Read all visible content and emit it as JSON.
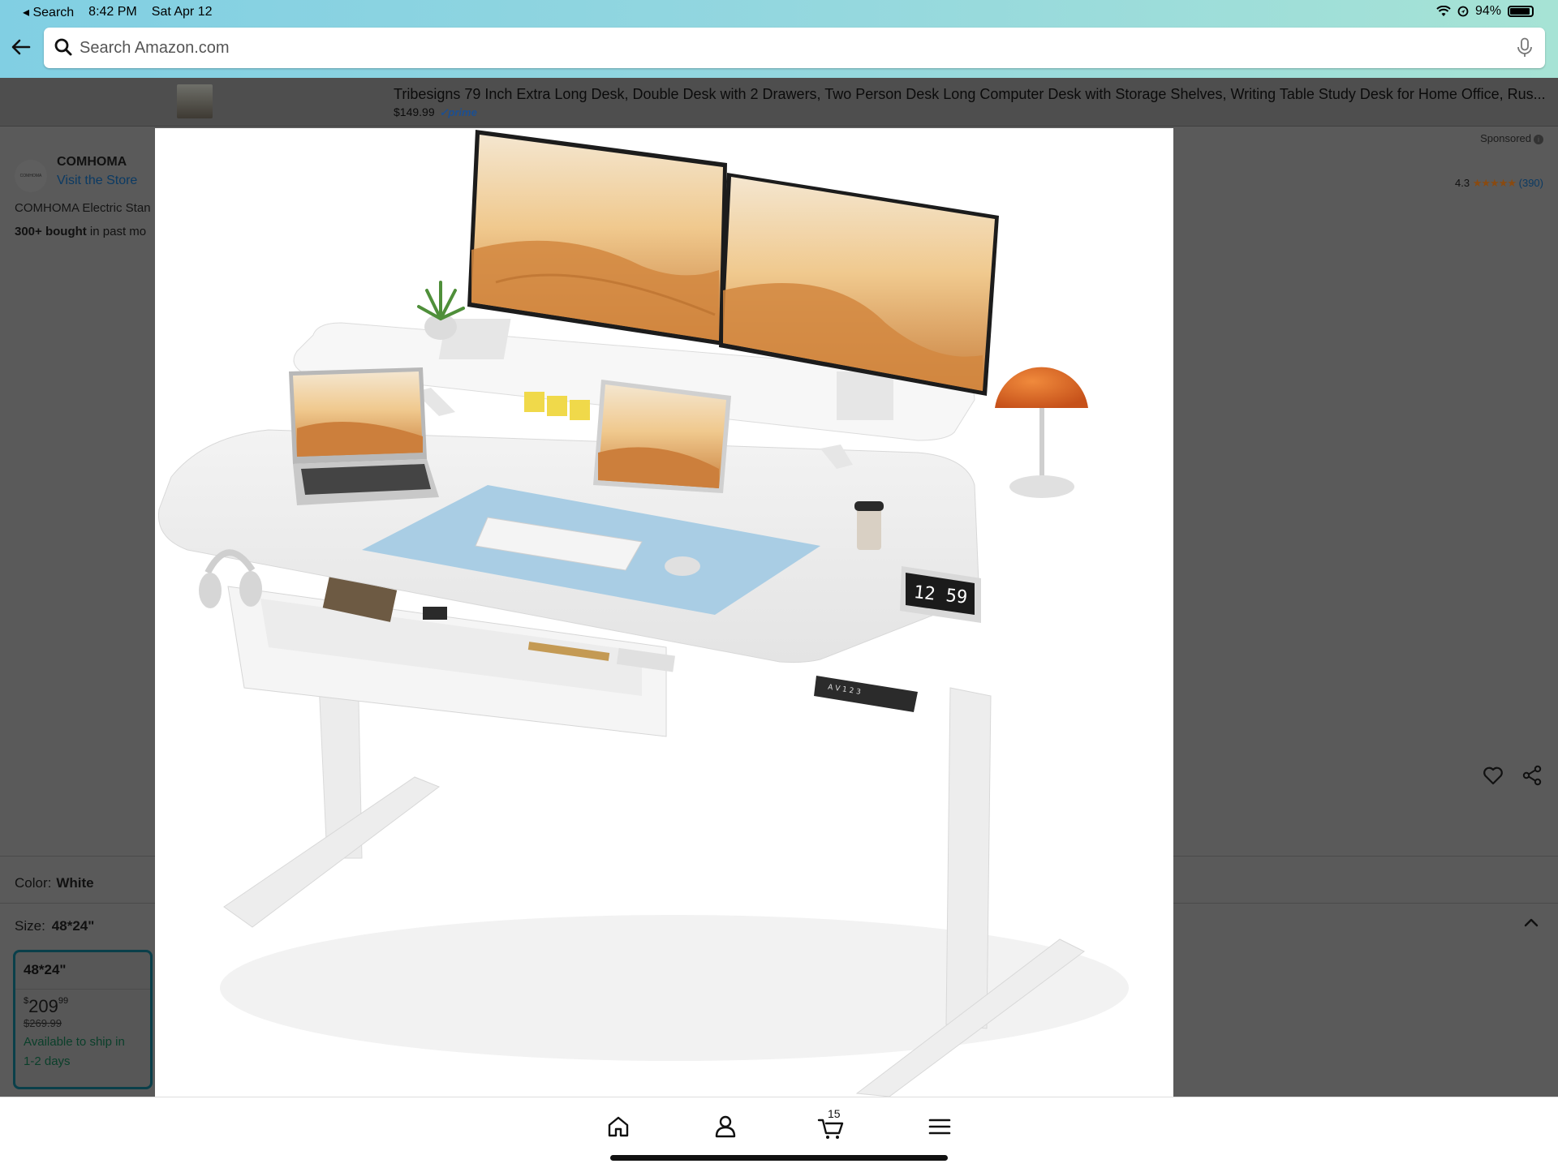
{
  "status_bar": {
    "back_app": "◂ Search",
    "time": "8:42 PM",
    "date": "Sat Apr 12",
    "battery": "94%"
  },
  "search": {
    "placeholder": "Search Amazon.com"
  },
  "ad": {
    "title": "Tribesigns 79 Inch Extra Long Desk, Double Desk with 2 Drawers, Two Person Desk Long Computer Desk with Storage Shelves, Writing Table Study Desk for Home Office, Rus...",
    "price": "$149.99",
    "prime": "✓prime"
  },
  "product": {
    "brand_logo_text": "COMHOMA",
    "brand": "COMHOMA",
    "visit_store": "Visit the Store",
    "title_fragment": "COMHOMA Electric Stan",
    "bought_bold": "300+ bought",
    "bought_rest": " in past mo",
    "sponsored": "Sponsored",
    "rating_value": "4.3",
    "rating_stars": "★★★★★",
    "rating_count": "(390)",
    "color_label": "Color:",
    "color_value": "White",
    "size_label": "Size:",
    "size_value": "48*24\""
  },
  "size_option": {
    "label": "48*24\"",
    "price_symbol": "$",
    "price_whole": "209",
    "price_fraction": "99",
    "list_price": "$269.99",
    "ship_line1": "Available to ship in",
    "ship_line2": "1-2 days"
  },
  "image": {
    "clock_text": "12 59",
    "controller_text": "A V 1 2 3"
  },
  "bottom_nav": {
    "cart_count": "15"
  },
  "colors": {
    "header_gradient_start": "#81cfe3",
    "header_gradient_end": "#a6e3d5",
    "overlay_dim": "#5a5a5a",
    "mousepad": "#a9cde4",
    "lamp": "#e2641e",
    "store_link": "#0b3a63",
    "selected_border": "#0a3f4a"
  }
}
